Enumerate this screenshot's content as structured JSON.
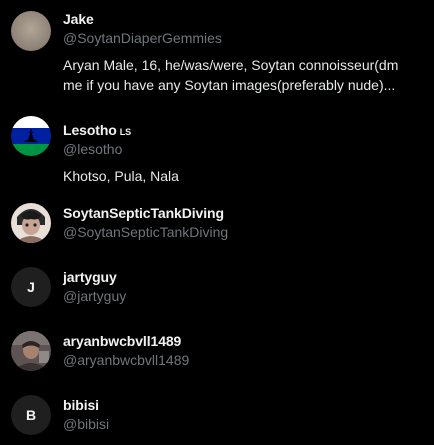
{
  "users": [
    {
      "display_name": "Jake",
      "handle": "@SoytanDiaperGemmies",
      "bio_line1": "Aryan Male, 16, he/was/were, Soytan connoisseur(dm",
      "bio_line2": "me if you have any Soytan images(preferably nude)..."
    },
    {
      "display_name": "Lesotho",
      "name_suffix": "LS",
      "handle": "@lesotho",
      "bio_line1": "Khotso, Pula, Nala"
    },
    {
      "display_name": "SoytanSepticTankDiving",
      "handle": "@SoytanSepticTankDiving"
    },
    {
      "display_name": "jartyguy",
      "handle": "@jartyguy",
      "avatar_initial": "J"
    },
    {
      "display_name": "aryanbwcbvll1489",
      "handle": "@aryanbwcbvll1489"
    },
    {
      "display_name": "bibisi",
      "handle": "@bibisi",
      "avatar_initial": "B"
    }
  ],
  "colors": {
    "background": "#000000",
    "name": "#f2f2f2",
    "handle": "#71767b",
    "bio": "#e7e9ea",
    "lesotho_blue": "#00209f",
    "lesotho_green": "#009543"
  }
}
